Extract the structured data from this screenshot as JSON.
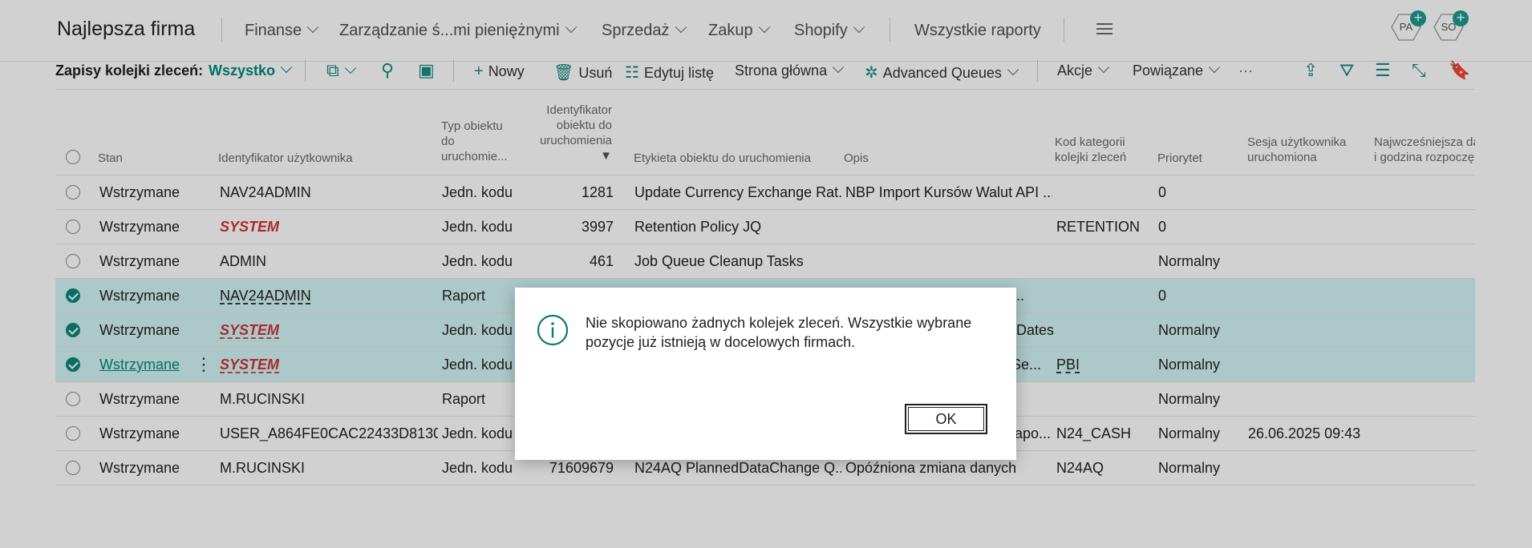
{
  "app": {
    "company": "Najlepsza firma",
    "menus": [
      "Finanse",
      "Zarządzanie ś...mi pieniężnymi",
      "Sprzedaż",
      "Zakup",
      "Shopify"
    ],
    "all_reports": "Wszystkie raporty",
    "avatars": [
      "PA",
      "SO"
    ]
  },
  "actionbar": {
    "title": "Zapisy kolejki zleceń:",
    "filter": "Wszystko",
    "new": "Nowy",
    "delete": "Usuń",
    "edit_list": "Edytuj listę",
    "home": "Strona główna",
    "advanced_queues": "Advanced Queues",
    "actions": "Akcje",
    "related": "Powiązane",
    "more": "···"
  },
  "table": {
    "headers": {
      "status": "Stan",
      "user_id": "Identyfikator użytkownika",
      "object_type_1": "Typ obiektu",
      "object_type_2": "do",
      "object_type_3": "uruchomie...",
      "object_id_1": "Identyfikator",
      "object_id_2": "obiektu do",
      "object_id_3": "uruchomienia",
      "object_caption": "Etykieta obiektu do uruchomienia",
      "description": "Opis",
      "category_1": "Kod kategorii",
      "category_2": "kolejki zleceń",
      "priority": "Priorytet",
      "session_1": "Sesja użytkownika",
      "session_2": "uruchomiona",
      "earliest_1": "Najwcześniejsza da",
      "earliest_2": "i godzina rozpoczę"
    },
    "rows": [
      {
        "status": "Wstrzymane",
        "user": "NAV24ADMIN",
        "type": "Jedn. kodu",
        "id": "1281",
        "caption": "Update Currency Exchange Rat...",
        "desc": "NBP Import Kursów Walut API ...",
        "cat": "",
        "priority": "0",
        "session": ""
      },
      {
        "status": "Wstrzymane",
        "user": "SYSTEM",
        "type": "Jedn. kodu",
        "id": "3997",
        "caption": "Retention Policy JQ",
        "desc": "",
        "cat": "RETENTION",
        "priority": "0",
        "session": ""
      },
      {
        "status": "Wstrzymane",
        "user": "ADMIN",
        "type": "Jedn. kodu",
        "id": "461",
        "caption": "Job Queue Cleanup Tasks",
        "desc": "",
        "cat": "",
        "priority": "Normalny",
        "session": ""
      },
      {
        "status": "Wstrzymane",
        "user": "NAV24ADMIN",
        "type": "Raport",
        "id": "",
        "caption": "",
        "desc": "v c...",
        "cat": "",
        "priority": "0",
        "session": ""
      },
      {
        "status": "Wstrzymane",
        "user": "SYSTEM",
        "type": "Jedn. kodu",
        "id": "",
        "caption": "",
        "desc": "Dates",
        "cat": "",
        "priority": "Normalny",
        "session": ""
      },
      {
        "status": "Wstrzymane",
        "user": "SYSTEM",
        "type": "Jedn. kodu",
        "id": "",
        "caption": "",
        "desc": "Se...",
        "cat": "PBI",
        "priority": "Normalny",
        "session": ""
      },
      {
        "status": "Wstrzymane",
        "user": "M.RUCINSKI",
        "type": "Raport",
        "id": "",
        "caption": "",
        "desc": "",
        "cat": "",
        "priority": "Normalny",
        "session": ""
      },
      {
        "status": "Wstrzymane",
        "user": "USER_A864FE0CAC22433D8130B...",
        "type": "Jedn. kodu",
        "id": "",
        "caption": "",
        "desc": "apo...",
        "cat": "N24_CASH",
        "priority": "Normalny",
        "session": "26.06.2025 09:43"
      },
      {
        "status": "Wstrzymane",
        "user": "M.RUCINSKI",
        "type": "Jedn. kodu",
        "id": "71609679",
        "caption": "N24AQ PlannedDataChange Q...",
        "desc": "Opóźniona zmiana danych",
        "cat": "N24AQ",
        "priority": "Normalny",
        "session": ""
      }
    ]
  },
  "dialog": {
    "message": "Nie skopiowano żadnych kolejek zleceń. Wszystkie wybrane pozycje już istnieją w docelowych firmach.",
    "ok": "OK"
  },
  "colors": {
    "accent": "#00897b",
    "selected_row": "#d2f5f5",
    "system_user": "#d13438"
  }
}
